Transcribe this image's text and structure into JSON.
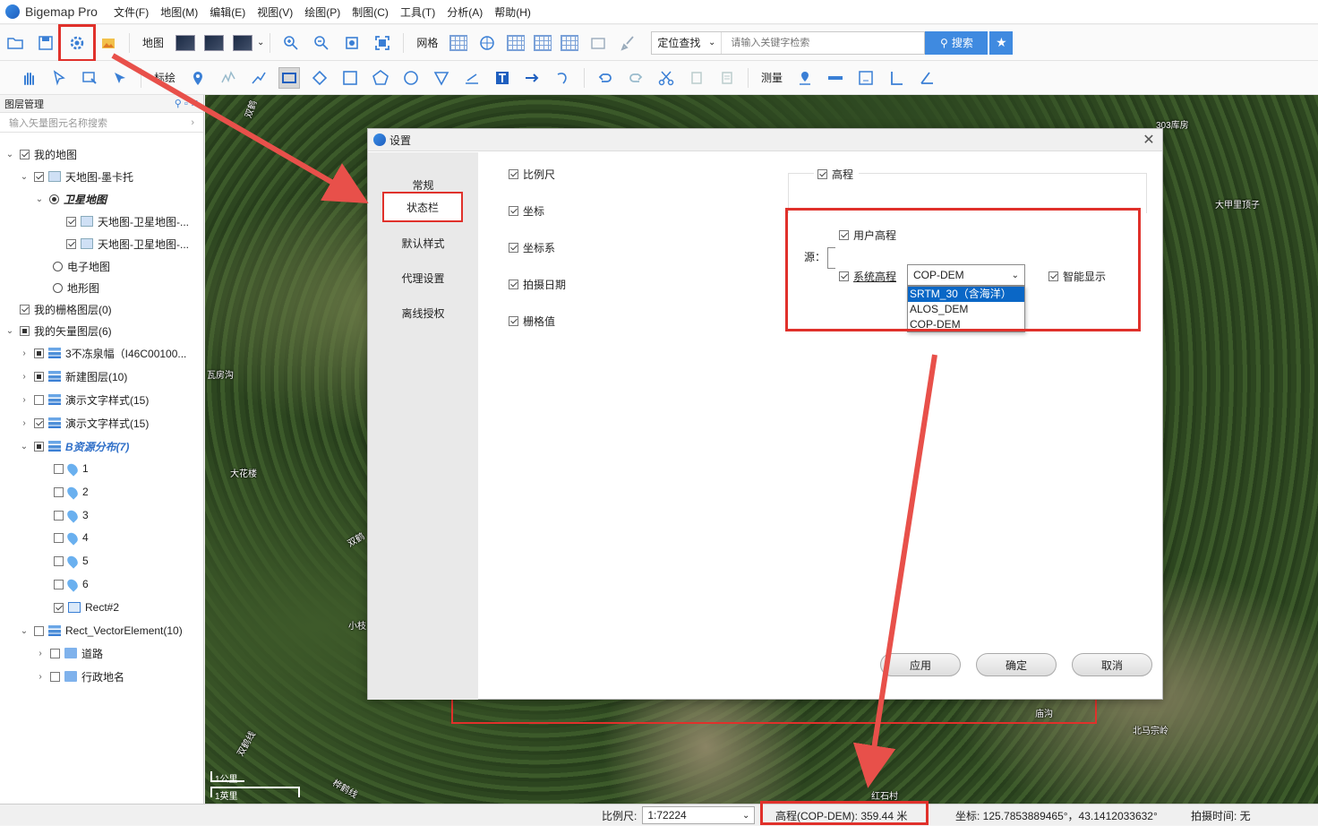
{
  "app": {
    "title": "Bigemap Pro"
  },
  "menu": [
    "文件(F)",
    "地图(M)",
    "编辑(E)",
    "视图(V)",
    "绘图(P)",
    "制图(C)",
    "工具(T)",
    "分析(A)",
    "帮助(H)"
  ],
  "toolbar1": {
    "map_label": "地图",
    "grid_label": "网格",
    "locate_select": "定位查找",
    "search_placeholder": "请输入关键字检索",
    "search_button": "搜索"
  },
  "toolbar2": {
    "draw_label": "标绘",
    "measure_label": "测量"
  },
  "layer_panel": {
    "title": "图层管理",
    "search_placeholder": "输入矢量图元名称搜索",
    "tree": [
      {
        "label": "我的地图"
      },
      {
        "label": "天地图-墨卡托"
      },
      {
        "label": "卫星地图"
      },
      {
        "label": "天地图-卫星地图-..."
      },
      {
        "label": "天地图-卫星地图-..."
      },
      {
        "label": "电子地图"
      },
      {
        "label": "地形图"
      },
      {
        "label": "我的栅格图层(0)"
      },
      {
        "label": "我的矢量图层(6)"
      },
      {
        "label": "3不冻泉幅（I46C00100..."
      },
      {
        "label": "新建图层(10)"
      },
      {
        "label": "演示文字样式(15)"
      },
      {
        "label": "演示文字样式(15)"
      },
      {
        "label": "B资源分布(7)"
      },
      {
        "label": "1"
      },
      {
        "label": "2"
      },
      {
        "label": "3"
      },
      {
        "label": "4"
      },
      {
        "label": "5"
      },
      {
        "label": "6"
      },
      {
        "label": "Rect#2"
      },
      {
        "label": "Rect_VectorElement(10)"
      },
      {
        "label": "道路"
      },
      {
        "label": "行政地名"
      }
    ]
  },
  "map": {
    "labels": [
      "双鹤",
      "303库房",
      "大甲里顶子",
      "瓦房沟",
      "大花楼",
      "双鹤",
      "小枝",
      "双鹤线",
      "庙沟",
      "北马宗岭",
      "红石村",
      "桦鹤线"
    ],
    "scale": {
      "km": "1公里",
      "mile": "1英里"
    }
  },
  "dialog": {
    "title": "设置",
    "nav": [
      "常规",
      "状态栏",
      "默认样式",
      "代理设置",
      "离线授权"
    ],
    "status_options": [
      "比例尺",
      "坐标",
      "坐标系",
      "拍摄日期",
      "栅格值"
    ],
    "elevation": {
      "group_label": "高程",
      "source_label": "源：",
      "user_elevation": "用户高程",
      "system_elevation": "系统高程",
      "smart_display": "智能显示",
      "selected_source": "COP-DEM",
      "options": [
        "SRTM_30（含海洋）",
        "ALOS_DEM",
        "COP-DEM"
      ]
    },
    "buttons": {
      "apply": "应用",
      "ok": "确定",
      "cancel": "取消"
    }
  },
  "statusbar": {
    "scale_label": "比例尺:",
    "scale_value": "1:72224",
    "elevation": "高程(COP-DEM): 359.44 米",
    "coordinates": "坐标:  125.7853889465°，43.1412033632°",
    "capture_time": "拍摄时间: 无"
  }
}
